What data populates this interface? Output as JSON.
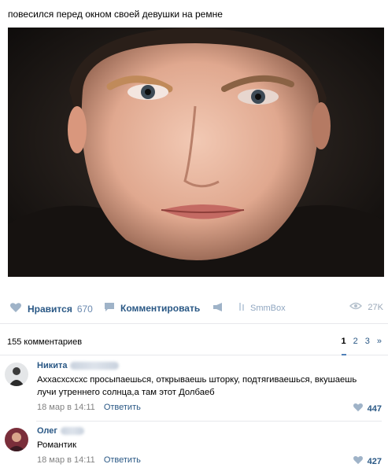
{
  "post": {
    "text": "повесился перед окном своей девушки на ремне"
  },
  "actions": {
    "like_label": "Нравится",
    "like_count": "670",
    "comment_label": "Комментировать",
    "brand": "SmmBox",
    "views": "27K"
  },
  "comments_header": {
    "count_label": "155 комментариев",
    "pages": [
      "1",
      "2",
      "3",
      "»"
    ]
  },
  "comments": [
    {
      "author": "Никита",
      "text": "Аххасхсхсхс просыпаешься, открываешь шторку, подтягиваешься, вкушаешь лучи утреннего солнца,а там этот Долбаеб",
      "date": "18 мар в 14:11",
      "reply": "Ответить",
      "likes": "447"
    },
    {
      "author": "Олег",
      "text": "Романтик",
      "date": "18 мар в 14:11",
      "reply": "Ответить",
      "likes": "427"
    }
  ],
  "colors": {
    "link": "#2a5885",
    "muted": "#828282",
    "divider": "#e7e8ec"
  },
  "icons": [
    "heart-icon",
    "comment-icon",
    "megaphone-icon",
    "brand-icon",
    "eye-icon"
  ]
}
